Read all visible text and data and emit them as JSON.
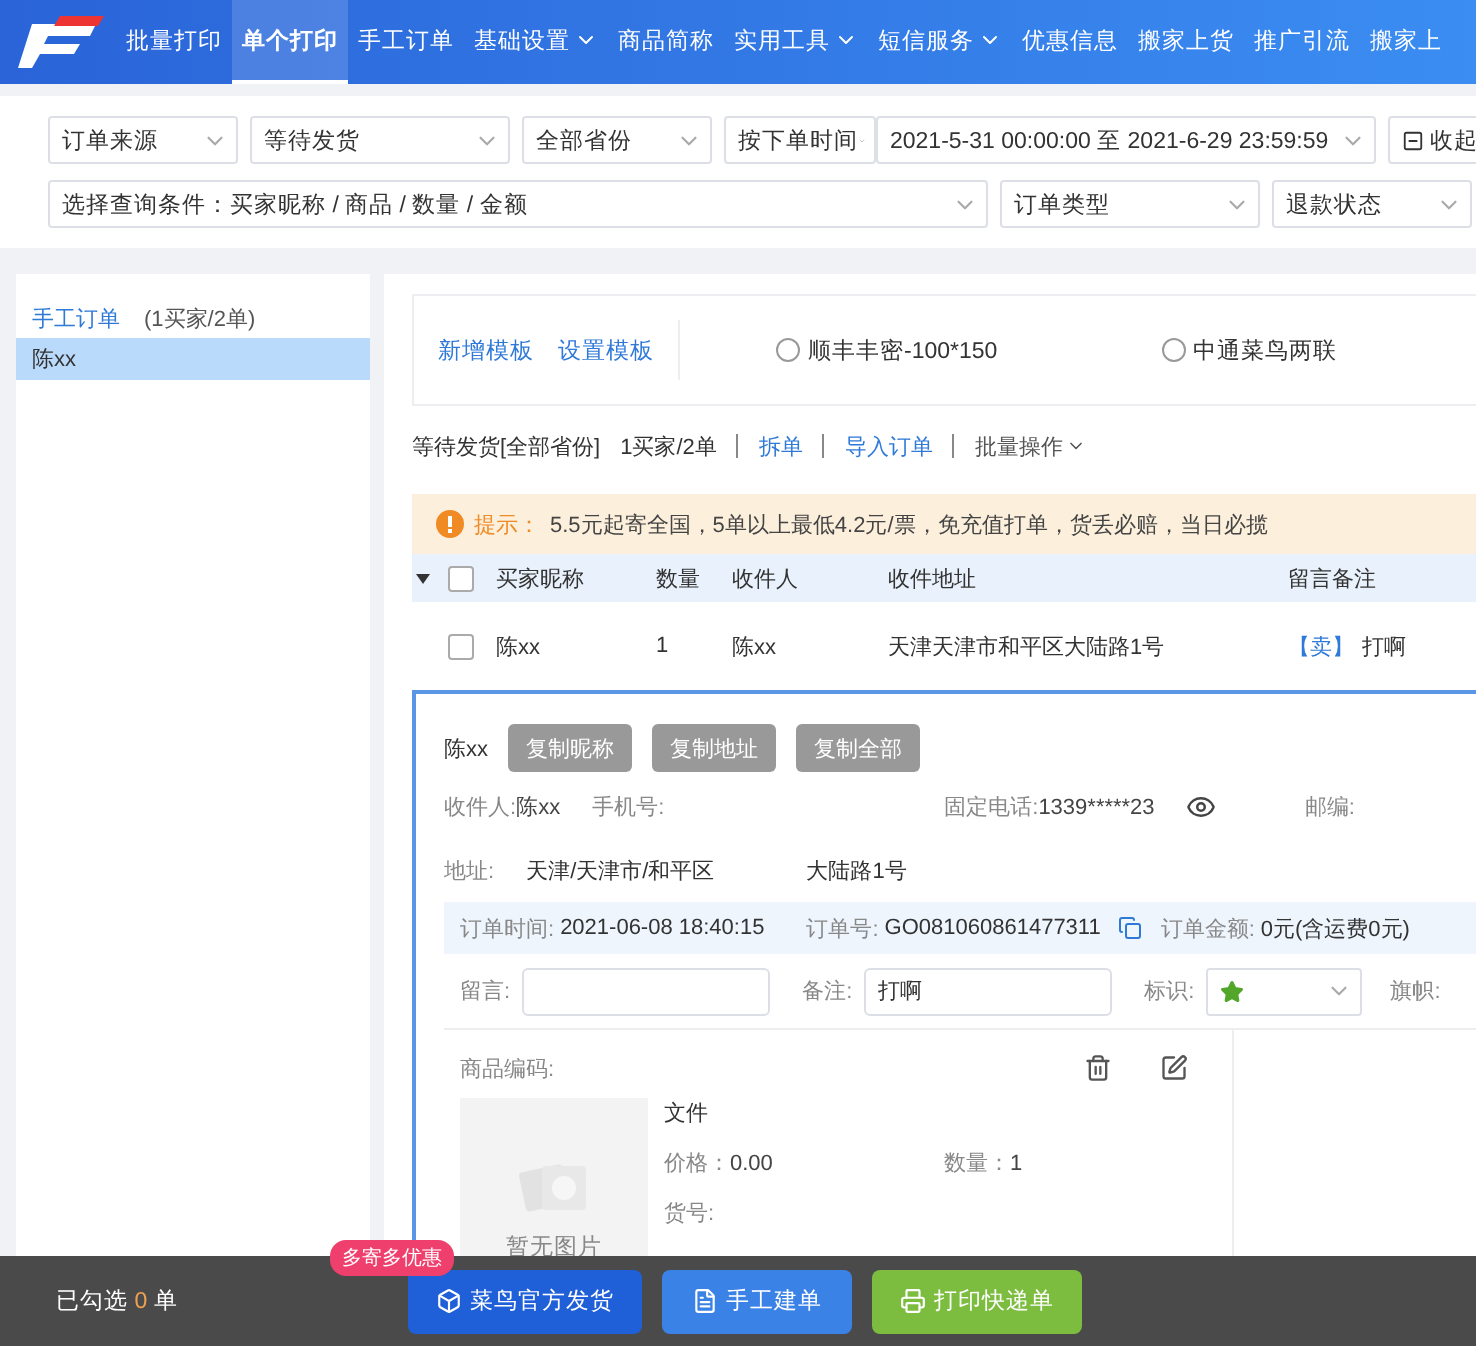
{
  "nav": {
    "items": [
      {
        "label": "批量打印",
        "selected": false,
        "dropdown": false
      },
      {
        "label": "单个打印",
        "selected": true,
        "dropdown": false
      },
      {
        "label": "手工订单",
        "selected": false,
        "dropdown": false
      },
      {
        "label": "基础设置",
        "selected": false,
        "dropdown": true
      },
      {
        "label": "商品简称",
        "selected": false,
        "dropdown": false
      },
      {
        "label": "实用工具",
        "selected": false,
        "dropdown": true
      },
      {
        "label": "短信服务",
        "selected": false,
        "dropdown": true
      },
      {
        "label": "优惠信息",
        "selected": false,
        "dropdown": false
      },
      {
        "label": "搬家上货",
        "selected": false,
        "dropdown": false
      },
      {
        "label": "推广引流",
        "selected": false,
        "dropdown": false
      },
      {
        "label": "搬家上",
        "selected": false,
        "dropdown": false
      }
    ]
  },
  "filters": {
    "row1": [
      {
        "kind": "select",
        "value": "订单来源"
      },
      {
        "kind": "select",
        "value": "等待发货"
      },
      {
        "kind": "select",
        "value": "全部省份"
      },
      {
        "kind": "daterange",
        "value": "按下单时间",
        "range": "2021-5-31 00:00:00 至 2021-6-29 23:59:59"
      },
      {
        "kind": "button",
        "value": "收起"
      }
    ],
    "row2": [
      {
        "kind": "wide",
        "value": "选择查询条件：买家昵称 / 商品 / 数量 / 金额"
      },
      {
        "kind": "select",
        "value": "订单类型"
      },
      {
        "kind": "select",
        "value": "退款状态"
      }
    ]
  },
  "sidebar": {
    "group": {
      "label": "手工订单",
      "count": "(1买家/2单)"
    },
    "items": [
      {
        "label": "陈xx",
        "selected": true
      }
    ]
  },
  "templates": {
    "links": [
      "新增模板",
      "设置模板"
    ],
    "options": [
      {
        "label": "顺丰丰密-100*150",
        "selected": false
      },
      {
        "label": "中通菜鸟两联",
        "selected": false
      }
    ]
  },
  "summary": {
    "status": "等待发货[全部省份]",
    "count": "1买家/2单",
    "actions": [
      {
        "label": "拆单",
        "kind": "link"
      },
      {
        "label": "导入订单",
        "kind": "link"
      },
      {
        "label": "批量操作",
        "kind": "menu"
      }
    ]
  },
  "notice": {
    "label": "提示：",
    "text": "5.5元起寄全国，5单以上最低4.2元/票，免充值打单，货丢必赔，当日必揽"
  },
  "table": {
    "all_checked": false,
    "columns": [
      "买家昵称",
      "数量",
      "收件人",
      "收件地址",
      "留言备注"
    ],
    "rows": [
      {
        "checked": false,
        "cells": [
          "陈xx",
          "1",
          "陈xx",
          "天津天津市和平区大陆路1号"
        ],
        "note_tag": "【卖】",
        "note": "打啊"
      }
    ]
  },
  "detail": {
    "name": "陈xx",
    "buttons": [
      "复制昵称",
      "复制地址",
      "复制全部"
    ],
    "info": [
      {
        "label": "收件人:",
        "value": "陈xx"
      },
      {
        "label": "手机号:"
      },
      {
        "label": "固定电话:",
        "value": "1339*****23"
      },
      {
        "label": "邮编:"
      }
    ],
    "address": {
      "label": "地址:",
      "region": "天津/天津市/和平区",
      "street": "大陆路1号"
    },
    "order": {
      "time_label": "订单时间:",
      "time": "2021-06-08 18:40:15",
      "no_label": "订单号:",
      "no": "GO081060861477311",
      "amount_label": "订单金额:",
      "amount": "0元(含运费0元)"
    },
    "fields": {
      "message_label": "留言:",
      "remark_label": "备注:",
      "remark": "打啊",
      "mark_label": "标识:",
      "flag_label": "旗帜:"
    },
    "product": {
      "code_label": "商品编码:",
      "image_text": "暂无图片",
      "name": "文件",
      "price_label": "价格：",
      "price": "0.00",
      "qty_label": "数量：",
      "qty": "1",
      "sku_label": "货号:"
    }
  },
  "footer": {
    "selected_label": "已勾选",
    "selected_count": "0",
    "selected_unit": "单",
    "badge": "多寄多优惠",
    "buttons": [
      {
        "label": "菜鸟官方发货",
        "kind": "cainiao"
      },
      {
        "label": "手工建单",
        "kind": "manual"
      },
      {
        "label": "打印快递单",
        "kind": "print"
      }
    ]
  }
}
